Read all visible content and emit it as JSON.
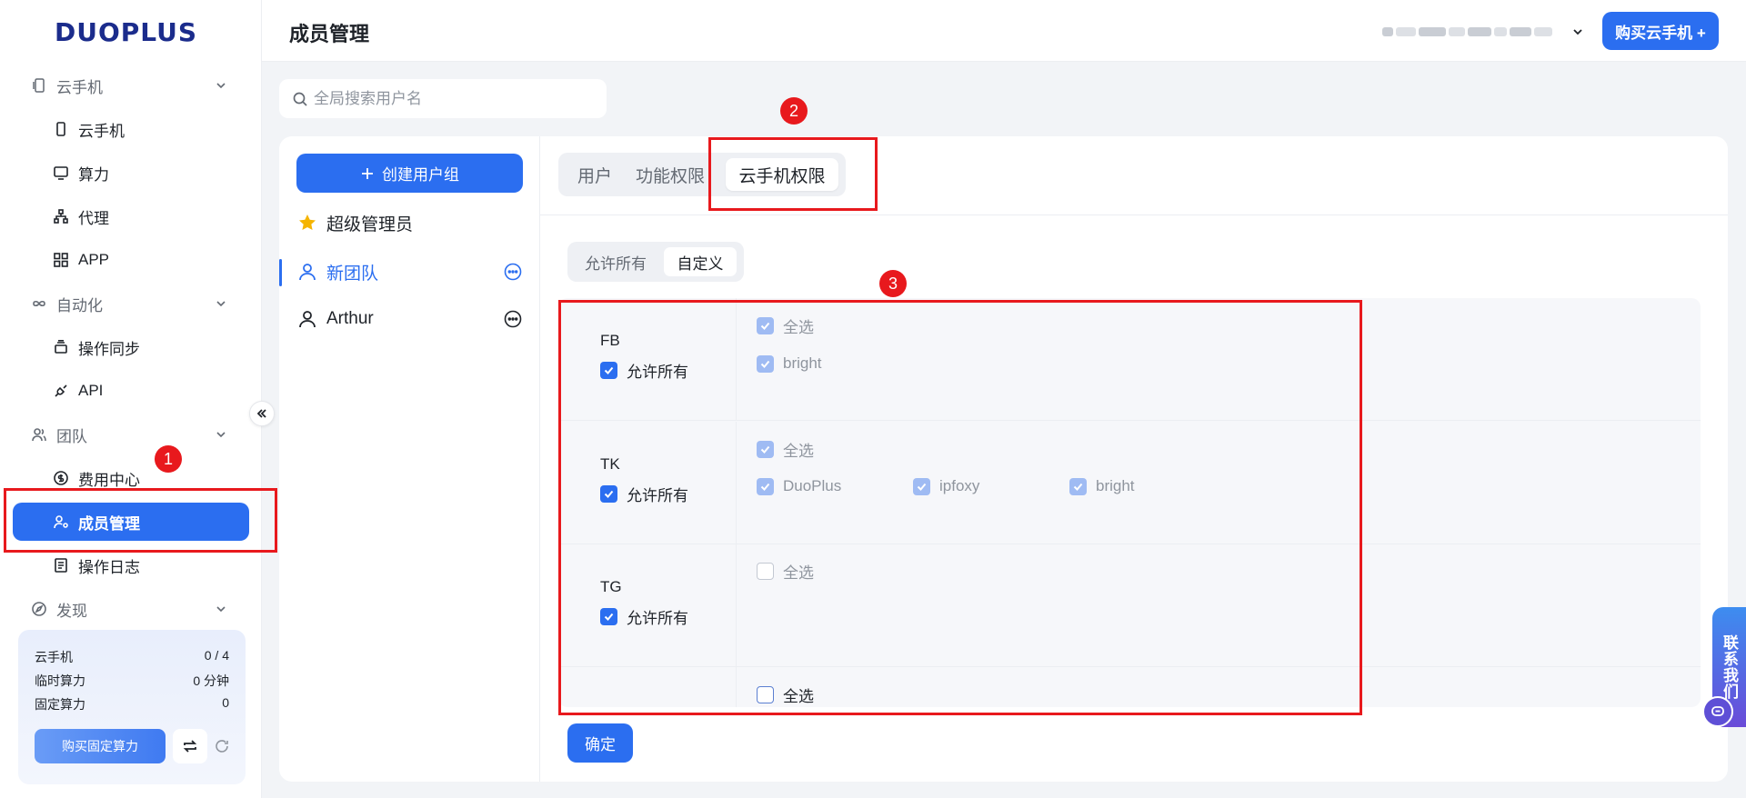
{
  "brand": {
    "name": "DUOPLUS"
  },
  "sidebar": {
    "groups": [
      {
        "label": "云手机",
        "icon": "phone-outline-icon",
        "items": [
          {
            "label": "云手机",
            "icon": "phone-icon"
          },
          {
            "label": "算力",
            "icon": "monitor-icon"
          },
          {
            "label": "代理",
            "icon": "network-icon"
          },
          {
            "label": "APP",
            "icon": "grid-icon"
          }
        ]
      },
      {
        "label": "自动化",
        "icon": "infinity-icon",
        "items": [
          {
            "label": "操作同步",
            "icon": "layers-icon"
          },
          {
            "label": "API",
            "icon": "plug-icon"
          }
        ]
      },
      {
        "label": "团队",
        "icon": "users-icon",
        "items": [
          {
            "label": "费用中心",
            "icon": "dollar-icon"
          },
          {
            "label": "成员管理",
            "icon": "user-settings-icon",
            "active": true
          },
          {
            "label": "操作日志",
            "icon": "doc-icon"
          }
        ]
      },
      {
        "label": "发现",
        "icon": "compass-icon",
        "items": []
      }
    ],
    "quota": {
      "rows": [
        {
          "label": "云手机",
          "value": "0 / 4"
        },
        {
          "label": "临时算力",
          "value": "0 分钟"
        },
        {
          "label": "固定算力",
          "value": "0"
        }
      ],
      "buy_fixed_label": "购买固定算力"
    }
  },
  "header": {
    "title": "成员管理",
    "buy_button": "购买云手机 +"
  },
  "search": {
    "placeholder": "全局搜索用户名"
  },
  "groups_panel": {
    "create_button": "创建用户组",
    "groups": [
      {
        "name": "超级管理员",
        "icon": "star-icon"
      },
      {
        "name": "新团队",
        "icon": "user-icon",
        "active": true
      },
      {
        "name": "Arthur",
        "icon": "user-icon"
      }
    ]
  },
  "tabs": [
    {
      "label": "用户"
    },
    {
      "label": "功能权限"
    },
    {
      "label": "云手机权限",
      "selected": true
    }
  ],
  "mode_toggle": {
    "options": [
      "允许所有",
      "自定义"
    ],
    "selected": "自定义"
  },
  "permissions": [
    {
      "app": "FB",
      "allow_all_label": "允许所有",
      "allow_all": true,
      "select_all_label": "全选",
      "options": [
        "bright"
      ]
    },
    {
      "app": "TK",
      "allow_all_label": "允许所有",
      "allow_all": true,
      "select_all_label": "全选",
      "options": [
        "DuoPlus",
        "ipfoxy",
        "bright"
      ]
    },
    {
      "app": "TG",
      "allow_all_label": "允许所有",
      "allow_all": true,
      "select_all_label": "全选",
      "options": []
    },
    {
      "app": "",
      "allow_all_label": "",
      "allow_all": false,
      "select_all_label": "全选",
      "options": []
    }
  ],
  "confirm_button": "确定",
  "annotations": {
    "badge1": "1",
    "badge2": "2",
    "badge3": "3"
  },
  "contact": {
    "label": "联系我们"
  },
  "colors": {
    "accent": "#2b6ef0",
    "annotation": "#e8191d"
  }
}
